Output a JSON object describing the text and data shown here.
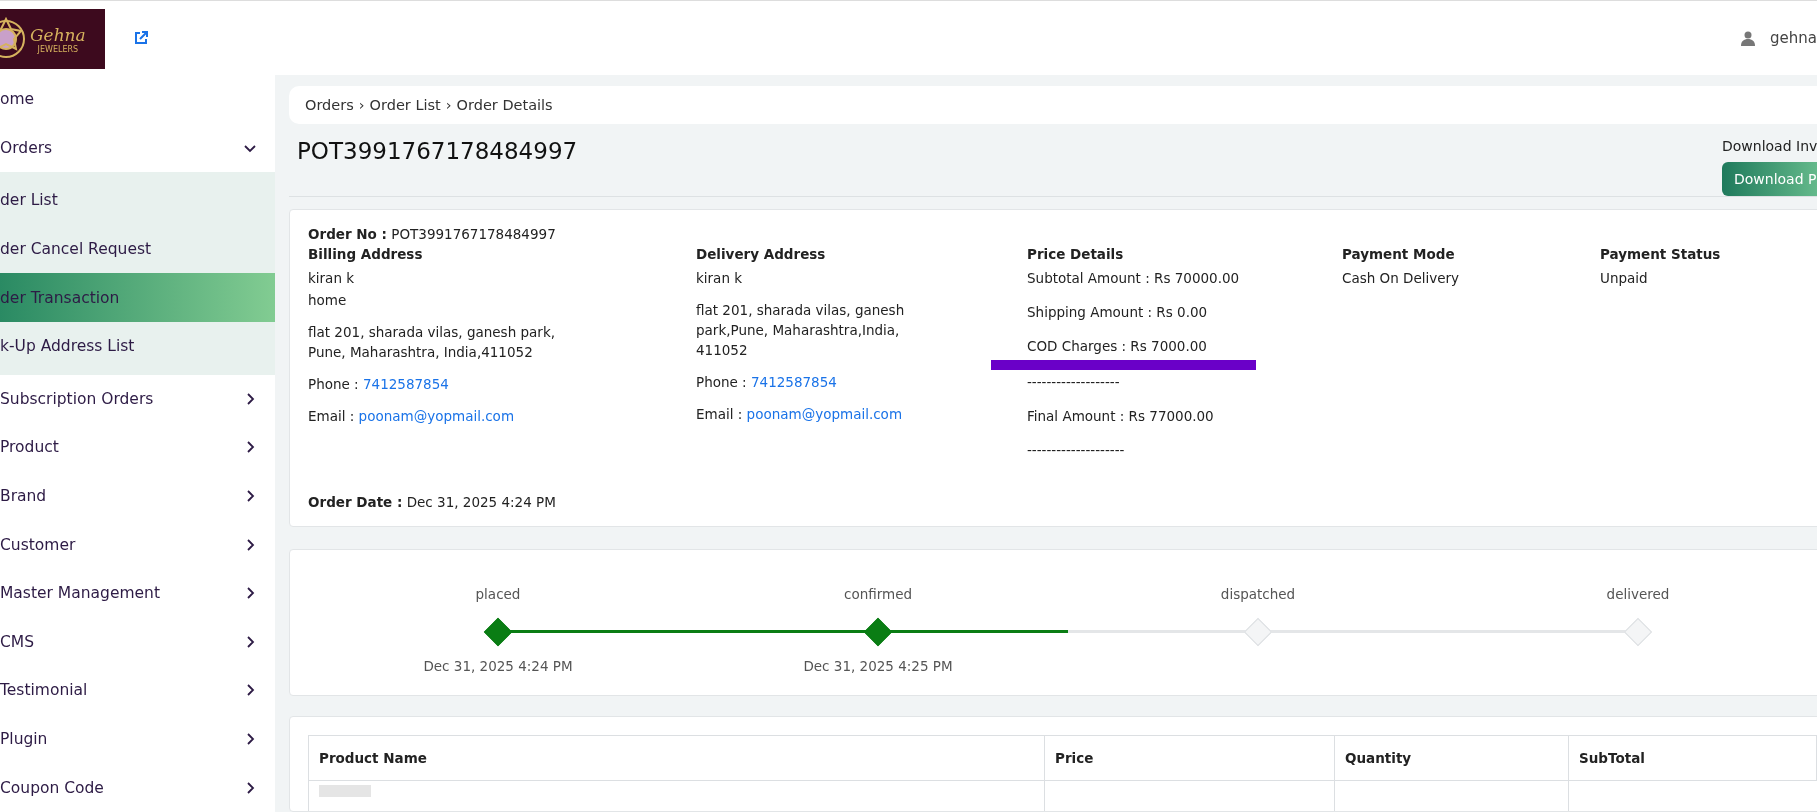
{
  "header": {
    "logo_text": "Gehna",
    "logo_subtext": "JEWELERS",
    "user": "gehna"
  },
  "sidebar": {
    "items": [
      {
        "label": "ome",
        "kind": "link"
      },
      {
        "label": "Orders",
        "kind": "group",
        "expanded": true,
        "children": [
          {
            "label": "der List",
            "selected": false
          },
          {
            "label": "der Cancel Request",
            "selected": false
          },
          {
            "label": "der Transaction",
            "selected": true
          },
          {
            "label": "k-Up Address List",
            "selected": false
          }
        ]
      },
      {
        "label": "Subscription Orders",
        "kind": "group",
        "expanded": false
      },
      {
        "label": "Product",
        "kind": "group",
        "expanded": false
      },
      {
        "label": "Brand",
        "kind": "group",
        "expanded": false
      },
      {
        "label": "Customer",
        "kind": "group",
        "expanded": false
      },
      {
        "label": "Master Management",
        "kind": "group",
        "expanded": false
      },
      {
        "label": "CMS",
        "kind": "group",
        "expanded": false
      },
      {
        "label": "Testimonial",
        "kind": "group",
        "expanded": false
      },
      {
        "label": "Plugin",
        "kind": "group",
        "expanded": false
      },
      {
        "label": "Coupon Code",
        "kind": "group",
        "expanded": false
      }
    ]
  },
  "breadcrumb": [
    "Orders",
    "›",
    "Order List",
    "›",
    "Order Details"
  ],
  "page_title": "POT3991767178484997",
  "download": {
    "label": "Download Inv",
    "button": "Download P"
  },
  "order": {
    "order_no": "**Order No :**  POT3991767178484997",
    "billing": {
      "title": "Billing Address",
      "lines": [
        "kiran k",
        "home"
      ],
      "address": "flat 201, sharada vilas, ganesh park, Pune, Maharashtra, India,411052",
      "phone_label": "Phone :",
      "phone": "7412587854",
      "email_label": "Email :",
      "email": "poonam@yopmail.com"
    },
    "delivery": {
      "title": "Delivery Address",
      "lines": [
        "kiran k"
      ],
      "address": "flat 201, sharada vilas, ganesh park,Pune, Maharashtra,India, 411052",
      "phone_label": "Phone :",
      "phone": "7412587854",
      "email_label": "Email :",
      "email": "poonam@yopmail.com"
    },
    "price": {
      "title": "Price Details",
      "lines": [
        {
          "text": "Subtotal Amount : Rs 70000.00",
          "marked": false
        },
        {
          "text": "Shipping Amount : Rs 0.00",
          "marked": false
        },
        {
          "text": "COD Charges : Rs  7000.00",
          "marked": true
        },
        {
          "text": "-------------------",
          "marked": false
        },
        {
          "text": "Final Amount : Rs  77000.00",
          "marked": false
        },
        {
          "text": "--------------------",
          "marked": false
        }
      ]
    },
    "payment_mode": {
      "title": "Payment Mode",
      "value": "Cash On Delivery"
    },
    "payment_status": {
      "title": "Payment Status",
      "value": "Unpaid"
    },
    "order_date": "**Order Date :** Dec 31, 2025 4:24 PM"
  },
  "timeline": [
    {
      "label": "placed",
      "completed": true,
      "date": "Dec 31, 2025 4:24 PM"
    },
    {
      "label": "confirmed",
      "completed": true,
      "date": "Dec 31, 2025 4:25 PM"
    },
    {
      "label": "dispatched",
      "completed": false
    },
    {
      "label": "delivered",
      "completed": false
    }
  ],
  "table": {
    "columns": [
      "Product Name",
      "Price",
      "Quantity",
      "SubTotal"
    ]
  }
}
